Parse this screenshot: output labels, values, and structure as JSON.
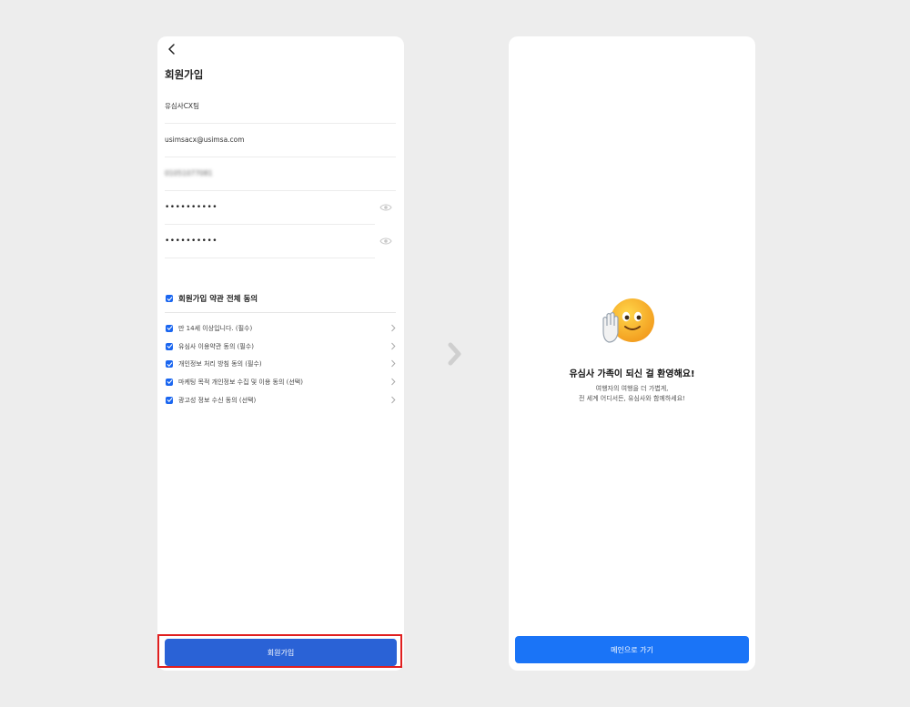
{
  "signup": {
    "title": "회원가입",
    "fields": {
      "name": "유심사CX팀",
      "email": "usimsacx@usimsa.com",
      "phone": "01051077081",
      "password": "••••••••••",
      "password_confirm": "••••••••••"
    },
    "agree_all_label": "회원가입 약관 전체 동의",
    "terms": [
      "만 14세 이상입니다. (필수)",
      "유심사 이용약관 동의 (필수)",
      "개인정보 처리 방침 동의 (필수)",
      "마케팅 목적 개인정보 수집 및 이용 동의 (선택)",
      "광고성 정보 수신 동의 (선택)"
    ],
    "submit_label": "회원가입"
  },
  "welcome": {
    "title": "유심사 가족이 되신 걸 환영해요!",
    "subtitle_line1": "여행자의 여행을 더 가볍게,",
    "subtitle_line2": "전 세계 어디서든, 유심사와 함께하세요!",
    "main_button_label": "메인으로 가기"
  },
  "icons": {
    "back": "chevron-left-icon",
    "eye": "eye-icon",
    "check": "checkbox-checked-icon",
    "chevron": "chevron-right-icon",
    "flow": "chevron-right-icon",
    "emoji": "waving-face-emoji"
  },
  "colors": {
    "primary": "#2a62d6",
    "main_button": "#1a74f7",
    "checkbox": "#1a66f0",
    "highlight": "#e01f1f"
  }
}
